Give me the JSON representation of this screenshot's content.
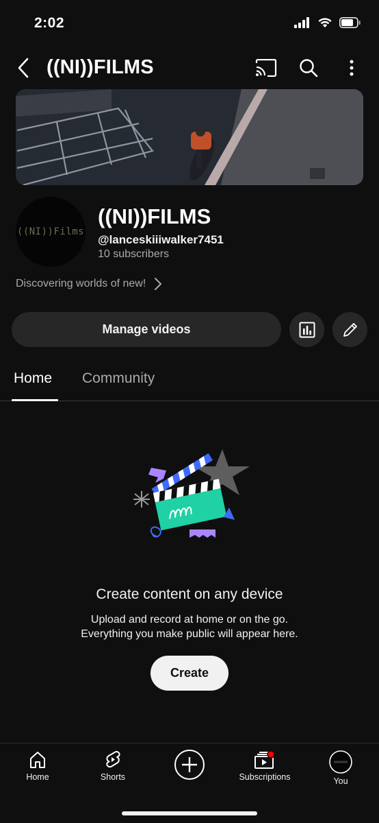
{
  "status": {
    "time": "2:02"
  },
  "header": {
    "title": "((NI))FILMS"
  },
  "channel": {
    "avatar_text": "((NI))Films",
    "name": "((NI))FILMS",
    "handle": "@lanceskiiiwalker7451",
    "subscribers": "10 subscribers",
    "description": "Discovering worlds of new!"
  },
  "actions": {
    "manage_label": "Manage videos"
  },
  "tabs": [
    {
      "label": "Home",
      "active": true
    },
    {
      "label": "Community",
      "active": false
    }
  ],
  "empty_state": {
    "title": "Create content on any device",
    "line1": "Upload and record at home or on the go.",
    "line2": "Everything you make public will appear here.",
    "button": "Create"
  },
  "nav": [
    {
      "label": "Home",
      "icon": "home-icon"
    },
    {
      "label": "Shorts",
      "icon": "shorts-icon"
    },
    {
      "label": "",
      "icon": "create-icon"
    },
    {
      "label": "Subscriptions",
      "icon": "subscriptions-icon"
    },
    {
      "label": "You",
      "icon": "avatar-icon"
    }
  ],
  "colors": {
    "background": "#0f0f0f",
    "surface": "#272727",
    "accent_red": "#ff0000",
    "teal": "#1fd1a5",
    "purple": "#a985ff",
    "blue": "#3e6bff"
  }
}
